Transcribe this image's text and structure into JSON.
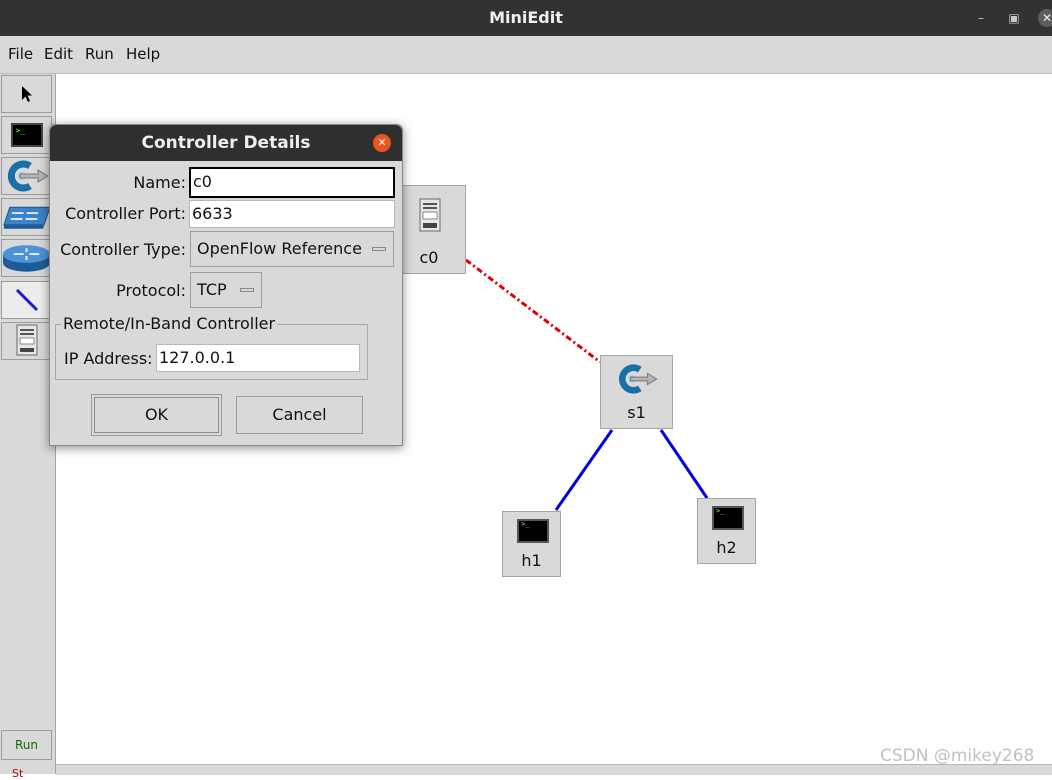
{
  "window": {
    "title": "MiniEdit"
  },
  "menu": {
    "items": [
      "File",
      "Edit",
      "Run",
      "Help"
    ]
  },
  "toolbar": {
    "tools": [
      "select-icon",
      "host-icon",
      "switch-icon",
      "legacy-switch-icon",
      "legacy-router-icon",
      "netlink-icon",
      "controller-icon"
    ],
    "run_label": "Run",
    "stop_label": "St"
  },
  "topology": {
    "nodes": {
      "c0": {
        "label": "c0",
        "icon": "controller-icon"
      },
      "s1": {
        "label": "s1",
        "icon": "switch-icon"
      },
      "h1": {
        "label": "h1",
        "icon": "host-icon"
      },
      "h2": {
        "label": "h2",
        "icon": "host-icon"
      }
    },
    "links": [
      {
        "from": "c0",
        "to": "s1",
        "style": "control",
        "color": "#dd0000"
      },
      {
        "from": "s1",
        "to": "h1",
        "style": "data",
        "color": "#0000dd"
      },
      {
        "from": "s1",
        "to": "h2",
        "style": "data",
        "color": "#0000dd"
      }
    ]
  },
  "dialog": {
    "title": "Controller Details",
    "name_label": "Name:",
    "name_value": "c0",
    "port_label": "Controller Port:",
    "port_value": "6633",
    "type_label": "Controller Type:",
    "type_value": "OpenFlow Reference",
    "protocol_label": "Protocol:",
    "protocol_value": "TCP",
    "group_label": "Remote/In-Band Controller",
    "ip_label": "IP Address:",
    "ip_value": "127.0.0.1",
    "ok_label": "OK",
    "cancel_label": "Cancel"
  },
  "watermark": "CSDN @mikey268",
  "colors": {
    "titlebar": "#323232",
    "panel": "#d9d9d9",
    "close_accent": "#e95420",
    "control_link": "#dd0000",
    "data_link": "#0000dd"
  }
}
